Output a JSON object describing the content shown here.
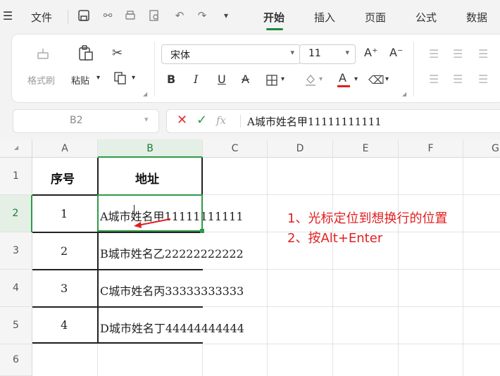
{
  "menubar": {
    "file_label": "文件",
    "tabs": [
      {
        "label": "开始",
        "active": true
      },
      {
        "label": "插入",
        "active": false
      },
      {
        "label": "页面",
        "active": false
      },
      {
        "label": "公式",
        "active": false
      },
      {
        "label": "数据",
        "active": false
      }
    ],
    "accent": "#1f8a3b"
  },
  "ribbon": {
    "format_painter": "格式刷",
    "paste": "粘贴",
    "font_name": "宋体",
    "font_size": "11",
    "increase_font": "A⁺",
    "decrease_font": "A⁻",
    "bold": "B",
    "italic": "I",
    "underline": "U",
    "strike": "A",
    "font_color_letter": "A",
    "font_color_bar": "#e02020"
  },
  "formula_bar": {
    "cell_ref": "B2",
    "fx": "fx",
    "content": "A城市姓名甲11111111111"
  },
  "grid": {
    "columns": [
      "A",
      "B",
      "C",
      "D",
      "E",
      "F",
      "G"
    ],
    "rows": [
      "1",
      "2",
      "3",
      "4",
      "5",
      "6"
    ],
    "selected_column": "B",
    "selected_row": "2",
    "header": {
      "a": "序号",
      "b": "地址"
    },
    "data": [
      {
        "a": "1",
        "b": "A城市姓名甲11111111111"
      },
      {
        "a": "2",
        "b": "B城市姓名乙22222222222"
      },
      {
        "a": "3",
        "b": "C城市姓名丙33333333333"
      },
      {
        "a": "4",
        "b": "D城市姓名丁44444444444"
      }
    ]
  },
  "annotations": {
    "step1": "1、光标定位到想换行的位置",
    "step2": "2、按Alt+Enter",
    "color": "#e02020"
  }
}
